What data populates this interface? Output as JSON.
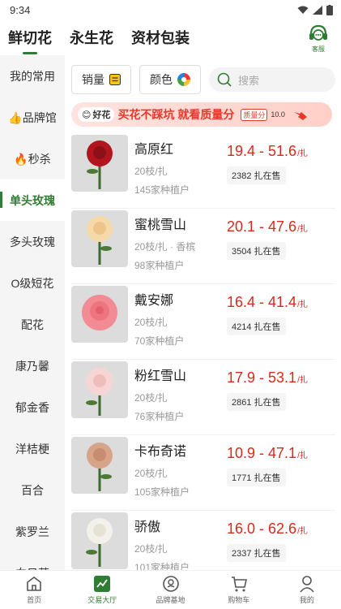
{
  "status": {
    "time": "9:34"
  },
  "top_tabs": [
    "鲜切花",
    "永生花",
    "资材包装"
  ],
  "service_label": "客服",
  "sidebar": [
    {
      "label": "我的常用"
    },
    {
      "label": "👍品牌馆"
    },
    {
      "label": "🔥秒杀"
    },
    {
      "label": "单头玫瑰",
      "active": true
    },
    {
      "label": "多头玫瑰"
    },
    {
      "label": "O级短花"
    },
    {
      "label": "配花"
    },
    {
      "label": "康乃馨"
    },
    {
      "label": "郁金香"
    },
    {
      "label": "洋桔梗"
    },
    {
      "label": "百合"
    },
    {
      "label": "紫罗兰"
    },
    {
      "label": "向日葵"
    }
  ],
  "filters": {
    "sales_label": "销量",
    "color_label": "颜色",
    "search_placeholder": "搜索"
  },
  "banner": {
    "badge": "好花",
    "text": "买花不踩坑 就看质量分",
    "score_label": "质量分",
    "score_value": "10.0"
  },
  "products": [
    {
      "name": "高原红",
      "spec": "20枝/扎",
      "origin": "145家种植户",
      "price": "19.4 - 51.6",
      "unit": "/扎",
      "stock": "2382 扎在售",
      "color": "#b3151f"
    },
    {
      "name": "蜜桃雪山",
      "spec": "20枝/扎 · 香槟",
      "origin": "98家种植户",
      "price": "20.1 - 47.6",
      "unit": "/扎",
      "stock": "3504 扎在售",
      "color": "#f6d9a8"
    },
    {
      "name": "戴安娜",
      "spec": "20枝/扎",
      "origin": "70家种植户",
      "price": "16.4 - 41.4",
      "unit": "/扎",
      "stock": "4214 扎在售",
      "color": "#f28b94"
    },
    {
      "name": "粉红雪山",
      "spec": "20枝/扎",
      "origin": "76家种植户",
      "price": "17.9 - 53.1",
      "unit": "/扎",
      "stock": "2861 扎在售",
      "color": "#f6d6d4"
    },
    {
      "name": "卡布奇诺",
      "spec": "20枝/扎",
      "origin": "105家种植户",
      "price": "10.9 - 47.1",
      "unit": "/扎",
      "stock": "1771 扎在售",
      "color": "#d7a48a"
    },
    {
      "name": "骄傲",
      "spec": "20枝/扎",
      "origin": "101家种植户",
      "price": "16.0 - 62.6",
      "unit": "/扎",
      "stock": "2337 扎在售",
      "color": "#f3f1ea"
    }
  ],
  "bottom_nav": [
    {
      "label": "首页",
      "icon": "home-icon"
    },
    {
      "label": "交易大厅",
      "icon": "trade-icon",
      "active": true
    },
    {
      "label": "品牌基地",
      "icon": "brand-icon"
    },
    {
      "label": "购物车",
      "icon": "cart-icon"
    },
    {
      "label": "我的",
      "icon": "user-icon"
    }
  ]
}
